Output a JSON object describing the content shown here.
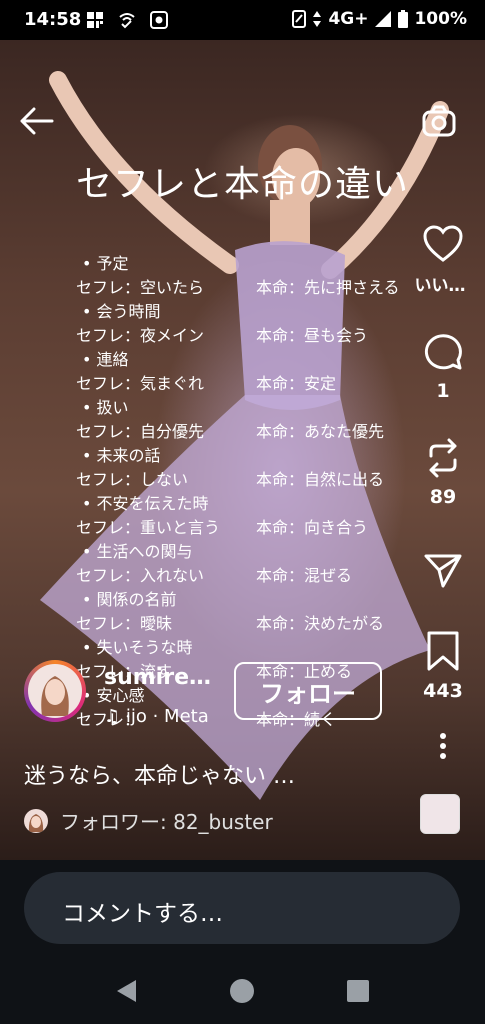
{
  "status_bar": {
    "time": "14:58",
    "network": "4G+",
    "battery": "100%"
  },
  "video": {
    "title": "セフレと本命の違い",
    "items": [
      {
        "heading": "予定",
        "sefure": "セフレ：空いたら",
        "honmei": "本命：先に押さえる"
      },
      {
        "heading": "会う時間",
        "sefure": "セフレ：夜メイン",
        "honmei": "本命：昼も会う"
      },
      {
        "heading": "連絡",
        "sefure": "セフレ：気まぐれ",
        "honmei": "本命：安定"
      },
      {
        "heading": "扱い",
        "sefure": "セフレ：自分優先",
        "honmei": "本命：あなた優先"
      },
      {
        "heading": "未来の話",
        "sefure": "セフレ：しない",
        "honmei": "本命：自然に出る"
      },
      {
        "heading": "不安を伝えた時",
        "sefure": "セフレ：重いと言う",
        "honmei": "本命：向き合う"
      },
      {
        "heading": "生活への関与",
        "sefure": "セフレ：入れない",
        "honmei": "本命：混ぜる"
      },
      {
        "heading": "関係の名前",
        "sefure": "セフレ：曖昧",
        "honmei": "本命：決めたがる"
      },
      {
        "heading": "失いそうな時",
        "sefure": "セフレ：流す",
        "honmei": "本命：止める"
      },
      {
        "heading": "安心感",
        "sefure": "セフレ：",
        "honmei": "本命：続く"
      }
    ]
  },
  "rail": {
    "like_label": "いい…",
    "comment_count": "1",
    "repost_count": "89",
    "save_count": "443"
  },
  "account": {
    "username": "sumire…",
    "music": "ijo · Meta",
    "follow_label": "フォロー"
  },
  "caption": "迷うなら、本命じゃない …",
  "followers_label": "フォロワー: 82_buster",
  "comment_placeholder": "コメントする…",
  "colors": {
    "background": "#000000",
    "comment_bar": "#262c34",
    "bottom_bg": "#0f1216"
  }
}
